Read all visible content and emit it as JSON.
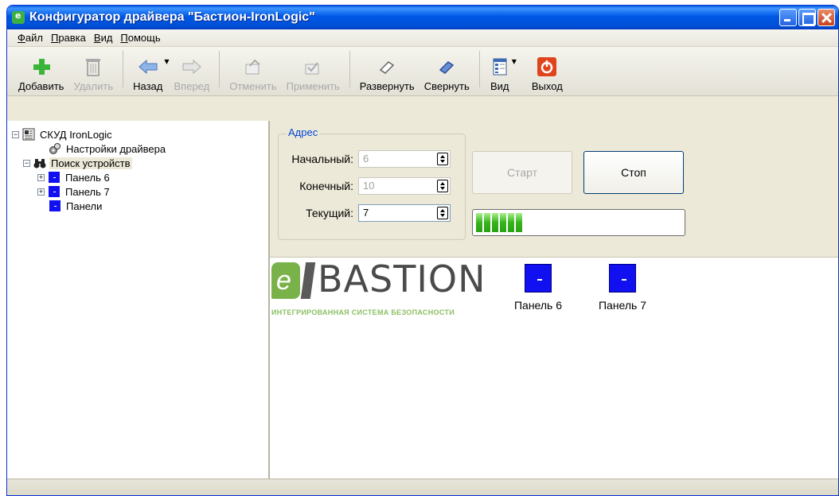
{
  "window": {
    "title": "Конфигуратор драйвера \"Бастион-IronLogic\""
  },
  "menu": [
    "Файл",
    "Правка",
    "Вид",
    "Помощь"
  ],
  "toolbar": {
    "add": "Добавить",
    "delete": "Удалить",
    "back": "Назад",
    "forward": "Вперед",
    "cancel": "Отменить",
    "apply": "Применить",
    "expand": "Развернуть",
    "collapse": "Свернуть",
    "view": "Вид",
    "exit": "Выход"
  },
  "tree": {
    "root": "СКУД IronLogic",
    "driver_settings": "Настройки драйвера",
    "device_search": "Поиск устройств",
    "panel6": "Панель  6",
    "panel7": "Панель  7",
    "panels": "Панели"
  },
  "address": {
    "legend": "Адрес",
    "start_label": "Начальный:",
    "start_value": "6",
    "end_label": "Конечный:",
    "end_value": "10",
    "current_label": "Текущий:",
    "current_value": "7"
  },
  "buttons": {
    "start": "Старт",
    "stop": "Стоп"
  },
  "progress": {
    "blocks": 6
  },
  "canvas": {
    "logo_text": "BASTION",
    "logo_letter": "e",
    "logo_subtitle": "ИНТЕГРИРОВАННАЯ СИСТЕМА БЕЗОПАСНОСТИ",
    "panel6": "Панель  6",
    "panel7": "Панель  7"
  },
  "colors": {
    "titlebar": "#0058e6",
    "panel": "#1010f0",
    "progress": "#36b41c",
    "logo_green": "#7ab24a"
  }
}
